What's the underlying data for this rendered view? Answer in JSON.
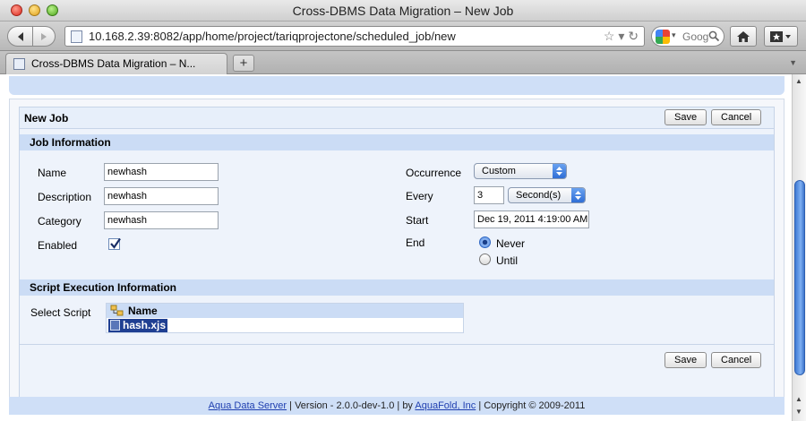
{
  "window": {
    "title": "Cross-DBMS Data Migration – New Job"
  },
  "browser": {
    "url": "10.168.2.39:8082/app/home/project/tariqprojectone/scheduled_job/new",
    "search_placeholder": "Goog",
    "tab_title": "Cross-DBMS Data Migration – N...",
    "new_tab_symbol": "+"
  },
  "panel": {
    "title": "New Job",
    "save_label": "Save",
    "cancel_label": "Cancel"
  },
  "job_info": {
    "title": "Job Information",
    "name_label": "Name",
    "name_value": "newhash",
    "description_label": "Description",
    "description_value": "newhash",
    "category_label": "Category",
    "category_value": "newhash",
    "enabled_label": "Enabled",
    "enabled_checked": true,
    "occurrence_label": "Occurrence",
    "occurrence_value": "Custom",
    "every_label": "Every",
    "every_value": "3",
    "every_unit": "Second(s)",
    "start_label": "Start",
    "start_value": "Dec 19, 2011 4:19:00 AM",
    "end_label": "End",
    "end_never_label": "Never",
    "end_until_label": "Until",
    "end_selected": "Never"
  },
  "script_info": {
    "title": "Script Execution Information",
    "select_label": "Select Script",
    "column_header": "Name",
    "selected_script": "hash.xjs"
  },
  "footer": {
    "link1": "Aqua Data Server",
    "version_text": " | Version - 2.0.0-dev-1.0 | by ",
    "link2": "AquaFold, Inc",
    "copyright": " | Copyright © 2009-2011"
  }
}
